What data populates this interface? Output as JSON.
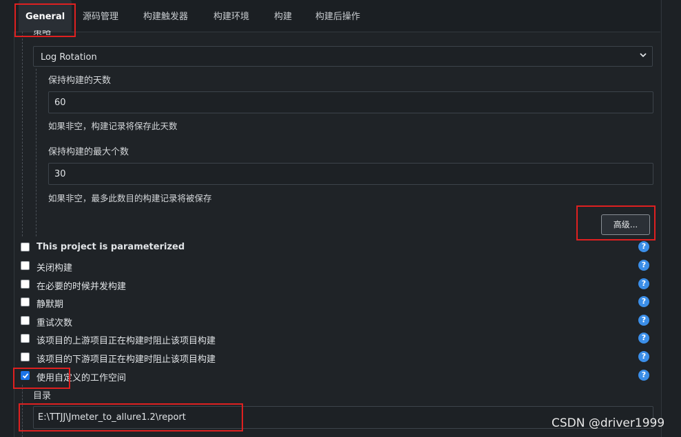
{
  "tabs": [
    {
      "label": "General"
    },
    {
      "label": "源码管理"
    },
    {
      "label": "构建触发器"
    },
    {
      "label": "构建环境"
    },
    {
      "label": "构建"
    },
    {
      "label": "构建后操作"
    }
  ],
  "strategy": {
    "label": "策略",
    "selected": "Log Rotation"
  },
  "days_to_keep": {
    "label": "保持构建的天数",
    "value": "60",
    "help": "如果非空，构建记录将保存此天数"
  },
  "max_builds": {
    "label": "保持构建的最大个数",
    "value": "30",
    "help": "如果非空，最多此数目的构建记录将被保存"
  },
  "advanced_button": "高级...",
  "options": [
    {
      "label": "This project is parameterized",
      "checked": false
    },
    {
      "label": "关闭构建",
      "checked": false
    },
    {
      "label": "在必要的时候并发构建",
      "checked": false
    },
    {
      "label": "静默期",
      "checked": false
    },
    {
      "label": "重试次数",
      "checked": false
    },
    {
      "label": "该项目的上游项目正在构建时阻止该项目构建",
      "checked": false
    },
    {
      "label": "该项目的下游项目正在构建时阻止该项目构建",
      "checked": false
    },
    {
      "label": "使用自定义的工作空间",
      "checked": true
    }
  ],
  "help_icon": "?",
  "workspace": {
    "label": "目录",
    "value": "E:\\TTJJ\\Jmeter_to_allure1.2\\report"
  },
  "watermark": "CSDN @driver1999",
  "colors": {
    "background": "#1d2125",
    "accent": "#3b8ee8",
    "highlight_box": "#e02020"
  }
}
